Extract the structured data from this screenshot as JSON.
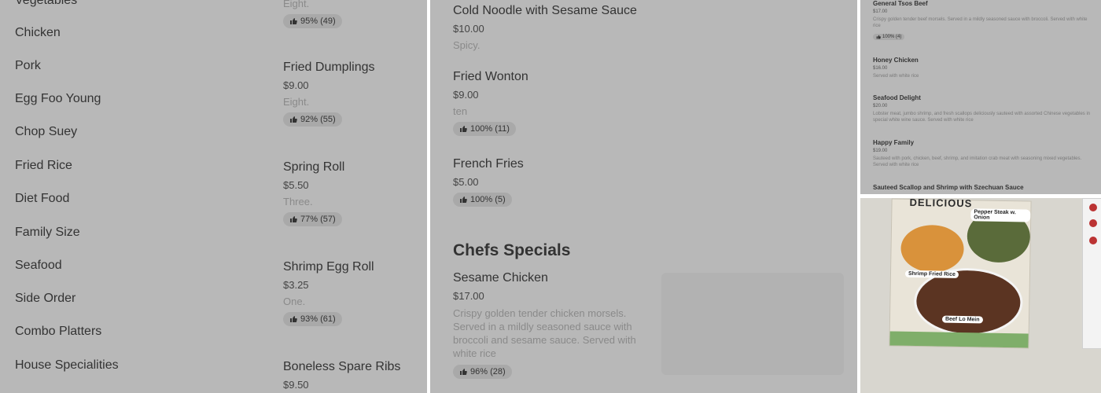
{
  "panel1": {
    "categories": [
      "Vegetables",
      "Chicken",
      "Pork",
      "Egg Foo Young",
      "Chop Suey",
      "Fried Rice",
      "Diet Food",
      "Family Size",
      "Seafood",
      "Side Order",
      "Combo Platters",
      "House Specialities"
    ],
    "items": [
      {
        "name": "",
        "price": "",
        "desc": "Eight.",
        "rating": "95% (49)"
      },
      {
        "name": "Fried Dumplings",
        "price": "$9.00",
        "desc": "Eight.",
        "rating": "92% (55)"
      },
      {
        "name": "Spring Roll",
        "price": "$5.50",
        "desc": "Three.",
        "rating": "77% (57)"
      },
      {
        "name": "Shrimp Egg Roll",
        "price": "$3.25",
        "desc": "One.",
        "rating": "93% (61)"
      },
      {
        "name": "Boneless Spare Ribs",
        "price": "$9.50",
        "desc": "",
        "rating": ""
      }
    ]
  },
  "panel2": {
    "items": [
      {
        "name": "Cold Noodle with Sesame Sauce",
        "price": "$10.00",
        "desc": "Spicy.",
        "rating": ""
      },
      {
        "name": "Fried Wonton",
        "price": "$9.00",
        "desc": "ten",
        "rating": "100% (11)"
      },
      {
        "name": "French Fries",
        "price": "$5.00",
        "desc": "",
        "rating": "100% (5)"
      }
    ],
    "section_title": "Chefs Specials",
    "special": {
      "name": "Sesame Chicken",
      "price": "$17.00",
      "desc": "Crispy golden tender chicken morsels. Served in a mildly seasoned sauce with broccoli and sesame sauce. Served with white rice",
      "rating": "96% (28)"
    }
  },
  "panel3": {
    "items": [
      {
        "name": "General Tsos Beef",
        "price": "$17.00",
        "desc": "Crispy golden tender beef morsels. Served in a mildly seasoned sauce with broccoli. Served with white rice",
        "rating": "100% (4)"
      },
      {
        "name": "Honey Chicken",
        "price": "$16.00",
        "desc": "Served with white rice",
        "rating": ""
      },
      {
        "name": "Seafood Delight",
        "price": "$20.00",
        "desc": "Lobster meat, jumbo shrimp, and fresh scallops deliciously sauteed with assorted Chinese vegetables in special white wine sauce. Served with white rice",
        "rating": ""
      },
      {
        "name": "Happy Family",
        "price": "$19.00",
        "desc": "Sauteed with pork, chicken, beef, shrimp, and imitation crab meat with seasoning mixed vegetables. Served with white rice",
        "rating": ""
      },
      {
        "name": "Sauteed Scallop and Shrimp with Szechuan Sauce",
        "price": "",
        "desc": "",
        "rating": ""
      }
    ]
  },
  "panel4": {
    "poster_title": "DELICIOUS",
    "labels": {
      "pepper": "Pepper Steak w. Onion",
      "rice": "Shrimp Fried Rice",
      "lomein": "Beef Lo Mein"
    }
  },
  "icons": {
    "rating": "thumbs-up-icon"
  },
  "colors": {
    "panel_bg": "#b8b8b8",
    "rating_bg": "#a9a9a9",
    "text": "#333333"
  }
}
